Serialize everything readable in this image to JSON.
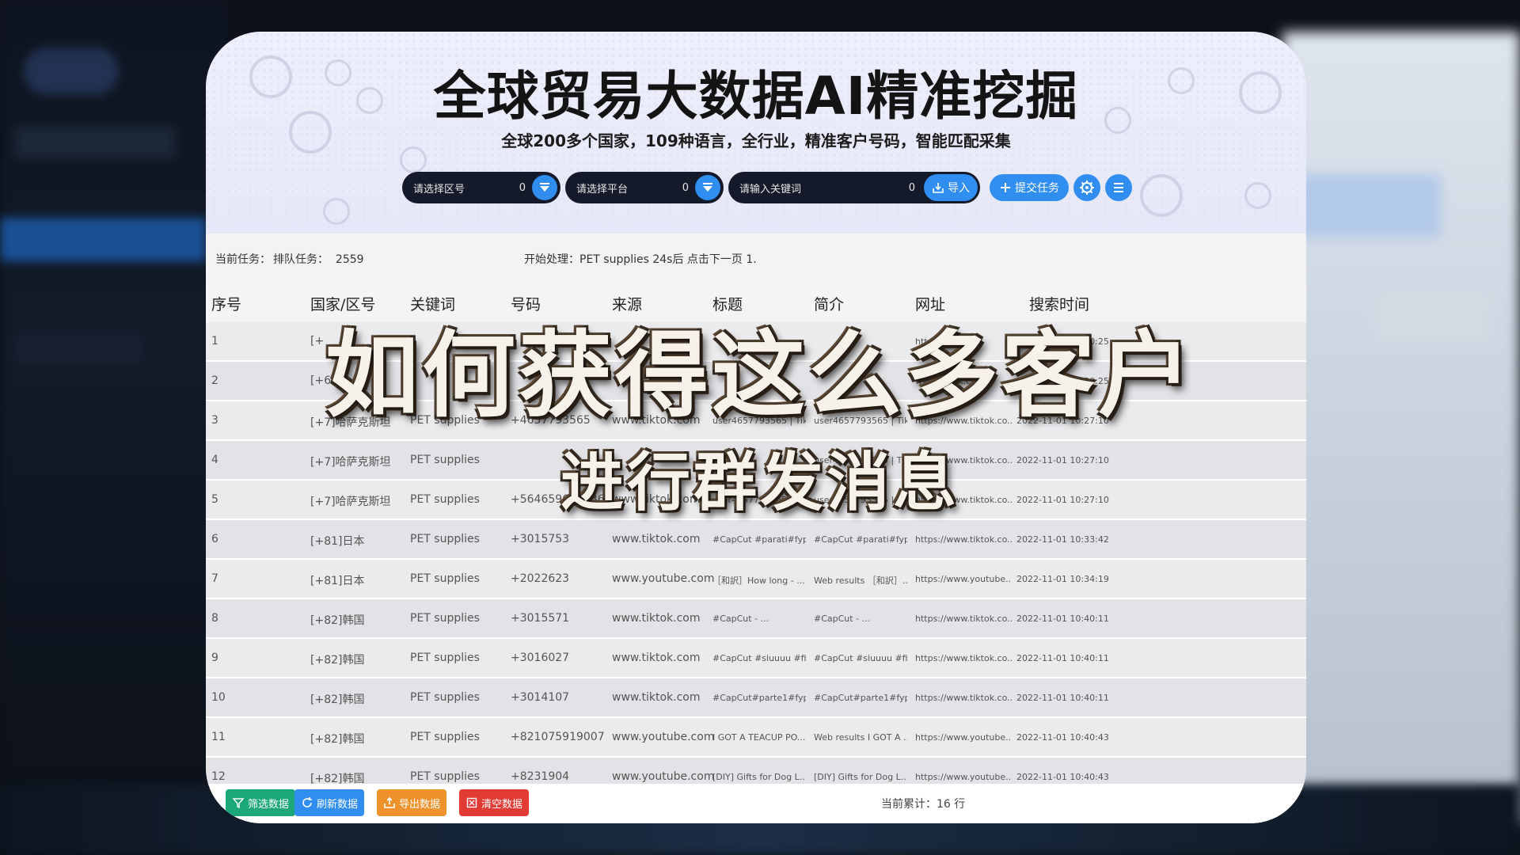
{
  "header": {
    "title": "全球贸易大数据AI精准挖掘",
    "subtitle": "全球200多个国家，109种语言，全行业，精准客户号码，智能匹配采集"
  },
  "toolbar": {
    "region_select": {
      "placeholder": "请选择区号",
      "count": "0"
    },
    "platform_select": {
      "placeholder": "请选择平台",
      "count": "0"
    },
    "keyword_input": {
      "placeholder": "请输入关键词",
      "count": "0"
    },
    "import_label": "导入",
    "submit_label": "提交任务",
    "icons": [
      "gear-icon",
      "list-icon"
    ]
  },
  "status": {
    "current_task_label": "当前任务：",
    "queue_label": "排队任务：",
    "queue_count": "2559",
    "processing_text": "开始处理：PET supplies 24s后 点击下一页 1."
  },
  "table": {
    "headers": [
      "序号",
      "国家/区号",
      "关键词",
      "号码",
      "来源",
      "标题",
      "简介",
      "网址",
      "搜索时间"
    ],
    "rows": [
      [
        "1",
        "[+",
        "",
        "",
        "",
        "",
        "",
        "htt",
        "2022-11-01 10:20:25"
      ],
      [
        "2",
        "[+6",
        "",
        "",
        "",
        "",
        "",
        "www.tiktok.co...",
        "2022-11-01 10:20:25"
      ],
      [
        "3",
        "[+7]哈萨克斯坦",
        "PET supplies",
        "+4657793565",
        "www.tiktok.com",
        "user4657793565 | Tik...",
        "user4657793565 | Tik...",
        "https://www.tiktok.co...",
        "2022-11-01 10:27:10"
      ],
      [
        "4",
        "[+7]哈萨克斯坦",
        "PET supplies",
        "",
        "",
        "",
        "user4657793565 | Tik...",
        "https://www.tiktok.co...",
        "2022-11-01 10:27:10"
      ],
      [
        "5",
        "[+7]哈萨克斯坦",
        "PET supplies",
        "+5646596749365",
        "www.tiktok.com",
        "user4657793565 | Tik...",
        "user4657793565 | Tik...",
        "https://www.tiktok.co...",
        "2022-11-01 10:27:10"
      ],
      [
        "6",
        "[+81]日本",
        "PET supplies",
        "+3015753",
        "www.tiktok.com",
        "#CapCut #parati#fyp...",
        "#CapCut #parati#fyp...",
        "https://www.tiktok.co...",
        "2022-11-01 10:33:42"
      ],
      [
        "7",
        "[+81]日本",
        "PET supplies",
        "+2022623",
        "www.youtube.com",
        "［和訳］How long - ...",
        "Web results ［和訳］...",
        "https://www.youtube...",
        "2022-11-01 10:34:19"
      ],
      [
        "8",
        "[+82]韩国",
        "PET supplies",
        "+3015571",
        "www.tiktok.com",
        "#CapCut - ...",
        "#CapCut - ...",
        "https://www.tiktok.co...",
        "2022-11-01 10:40:11"
      ],
      [
        "9",
        "[+82]韩国",
        "PET supplies",
        "+3016027",
        "www.tiktok.com",
        "#CapCut #siuuuu #fi...",
        "#CapCut #siuuuu #fi...",
        "https://www.tiktok.co...",
        "2022-11-01 10:40:11"
      ],
      [
        "10",
        "[+82]韩国",
        "PET supplies",
        "+3014107",
        "www.tiktok.com",
        "#CapCut#parte1#fyp...",
        "#CapCut#parte1#fyp...",
        "https://www.tiktok.co...",
        "2022-11-01 10:40:11"
      ],
      [
        "11",
        "[+82]韩国",
        "PET supplies",
        "+821075919007",
        "www.youtube.com",
        "I GOT A TEACUP PO...",
        "Web results I GOT A ...",
        "https://www.youtube...",
        "2022-11-01 10:40:43"
      ],
      [
        "12",
        "[+82]韩国",
        "PET supplies",
        "+8231904",
        "www.youtube.com",
        "[DIY] Gifts for Dog L...",
        "[DIY] Gifts for Dog L...",
        "https://www.youtube...",
        "2022-11-01 10:40:43"
      ]
    ]
  },
  "footer": {
    "filter_label": "筛选数据",
    "refresh_label": "刷新数据",
    "export_label": "导出数据",
    "clear_label": "清空数据",
    "total_text": "当前累计：16 行"
  },
  "overlay": {
    "line1": "如何获得这么多客户",
    "line2": "进行群发消息"
  },
  "colors": {
    "accent": "#2f8ef0",
    "filter_btn": "#1aa779",
    "refresh_btn": "#2f8ef0",
    "export_btn": "#f0922b",
    "clear_btn": "#e23b33"
  }
}
